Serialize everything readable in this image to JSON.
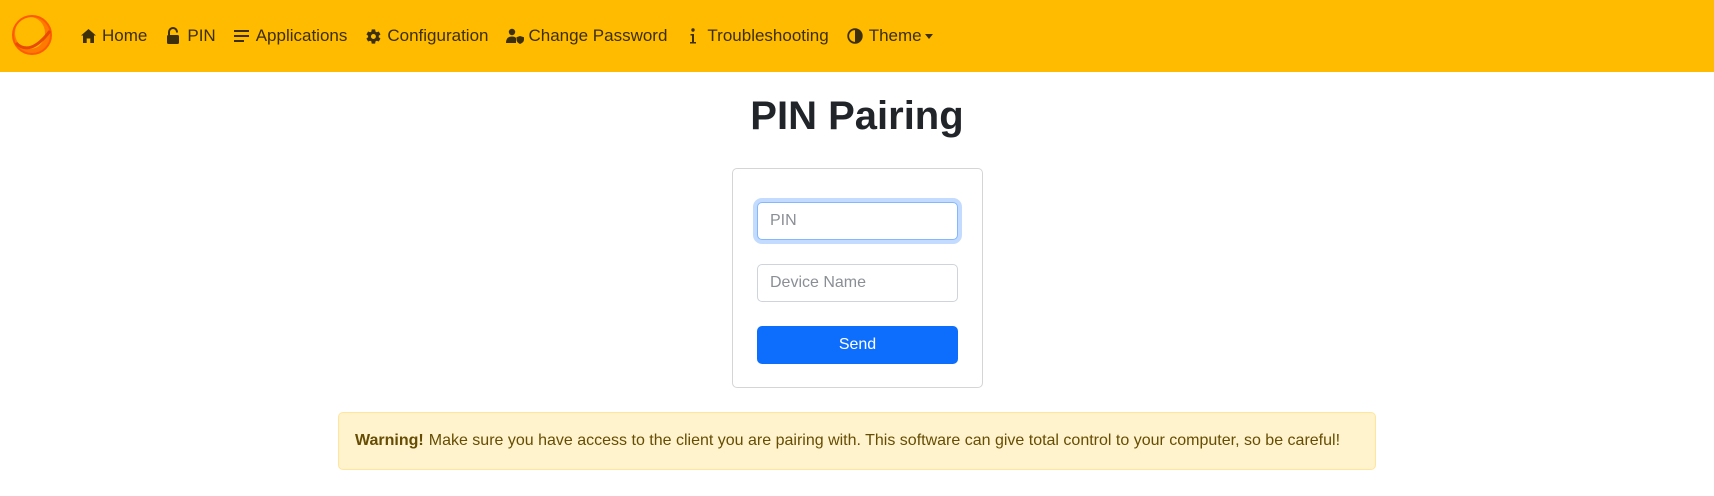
{
  "nav": {
    "items": [
      {
        "label": "Home",
        "icon": "home-icon"
      },
      {
        "label": "PIN",
        "icon": "unlock-icon"
      },
      {
        "label": "Applications",
        "icon": "list-icon"
      },
      {
        "label": "Configuration",
        "icon": "gear-icon"
      },
      {
        "label": "Change Password",
        "icon": "user-shield-icon"
      },
      {
        "label": "Troubleshooting",
        "icon": "info-icon"
      },
      {
        "label": "Theme",
        "icon": "contrast-icon"
      }
    ]
  },
  "page": {
    "title": "PIN Pairing"
  },
  "form": {
    "pin_placeholder": "PIN",
    "pin_value": "",
    "device_placeholder": "Device Name",
    "device_value": "",
    "send_label": "Send"
  },
  "warning": {
    "strong": "Warning!",
    "text": "Make sure you have access to the client you are pairing with. This software can give total control to your computer, so be careful!"
  },
  "colors": {
    "navbar": "#ffbb00",
    "primary": "#0d6efd",
    "warning_bg": "#fff3cd"
  }
}
